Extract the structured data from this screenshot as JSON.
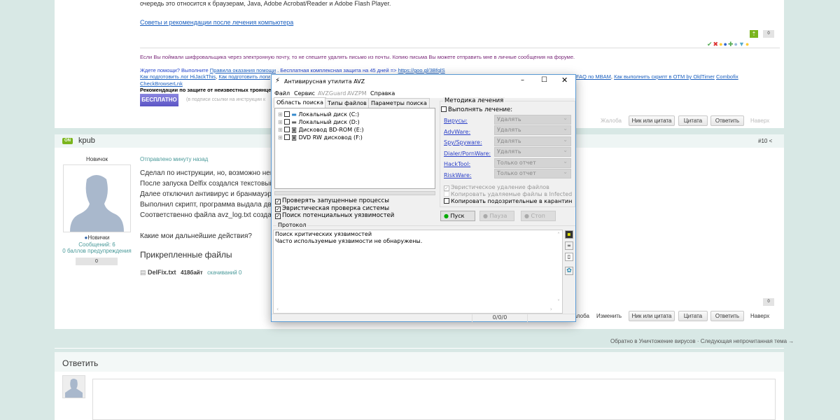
{
  "top_post": {
    "text_line": "очередь это относится к браузерам, Java, Adobe Acrobat/Reader и Adobe Flash Player.",
    "advice_link": "Советы и рекомендации после лечения компьютера",
    "rep": "0"
  },
  "signature": {
    "warning": "Если Вы поймали шифровальщика через электронную почту, то не спешите удалять письмо из почты. Копию письма Вы можете отправить мне в личные сообщения на форуме.",
    "help_prefix": "Ждете помощи? Выполните",
    "rules_link": "Правила оказания помощи",
    "free_text": ". Бесплатная комплексная защита на 45 дней =>",
    "free_link": "https://goo.gl/3BfqlS",
    "links_line1": [
      "Как подготовить лог HiJackThis",
      "Как подготовить логи"
    ],
    "links_line1_right": [
      "FAQ по MBAM",
      "Как выполнить скрипт в OTM by OldTimer",
      "Combofix"
    ],
    "links_line2": "CheckBrowserLnk",
    "recommend": "Рекомендации по защите от неизвестных троянце",
    "badge": "БЕСПЛАТНО",
    "badge_note": "(в подписи ссылки на инструкции к"
  },
  "actions1": {
    "report": "Жалоба",
    "nick": "Ник или цитата",
    "quote": "Цитата",
    "reply": "Ответить",
    "top": "Наверх"
  },
  "post": {
    "status": "ON",
    "author": "kpub",
    "number": "#10",
    "rank": "Новичок",
    "group": "Новички",
    "posts": "Сообщений: 6",
    "warn": "0 баллов предупреждения",
    "rep": "0",
    "time": "Отправлено минуту назад",
    "lines": [
      "Сделал по инструкции, но, возможно неправ",
      "После запуска Delfix создался текстовый доку",
      "Далее отключил антивирус и бранмауэр и за",
      "Выполнил скрипт, программа выдала два соо",
      "Соответственно файла  avz_log.txt создано н"
    ],
    "question": "Какие мои дальнейшие действия?",
    "attach_title": "Прикрепленные файлы",
    "file": "DelFix.txt",
    "size": "418байт",
    "downloads": "скачиваний 0",
    "post_rep": "0"
  },
  "actions2": {
    "report": "Жалоба",
    "edit": "Изменить",
    "nick": "Ник или цитата",
    "quote": "Цитата",
    "reply": "Ответить",
    "top": "Наверх"
  },
  "nav": {
    "back": "Обратно в Уничтожение вирусов",
    "sep": " · ",
    "next": "Следующая непрочитанная тема →"
  },
  "reply_box": {
    "title": "Ответить"
  },
  "avz": {
    "title": "Антивирусная утилита AVZ",
    "menu": [
      "Файл",
      "Сервис",
      "AVZGuard",
      "AVZPM",
      "Справка"
    ],
    "tabs": [
      "Область поиска",
      "Типы файлов",
      "Параметры поиска"
    ],
    "drives": [
      "Локальный диск (C:)",
      "Локальный диск (D:)",
      "Дисковод BD-ROM (E:)",
      "DVD RW дисковод (F:)"
    ],
    "checks": [
      "Проверять запущенные процессы",
      "Эвристическая проверка системы",
      "Поиск потенциальных уязвимостей"
    ],
    "method": {
      "title": "Методика лечения",
      "do_cure": "Выполнять лечение:",
      "rows": [
        {
          "label": "Вирусы:",
          "value": "Удалять"
        },
        {
          "label": "AdvWare:",
          "value": "Удалять"
        },
        {
          "label": "Spy/Spyware:",
          "value": "Удалять"
        },
        {
          "label": "Dialer/PornWare:",
          "value": "Удалять"
        },
        {
          "label": "HackTool:",
          "value": "Только отчет"
        },
        {
          "label": "RiskWare:",
          "value": "Только отчет"
        }
      ],
      "heur": "Эвристическое удаление файлов",
      "copy_infected": "Копировать удаляемые файлы в  Infected",
      "copy_quarantine": "Копировать подозрительные в  карантин"
    },
    "buttons": {
      "start": "Пуск",
      "pause": "Пауза",
      "stop": "Стоп"
    },
    "protocol": {
      "title": "Протокол",
      "lines": [
        "Поиск критических уязвимостей",
        "Часто используемые уязвимости не обнаружены."
      ]
    },
    "status": "0/0/0"
  }
}
